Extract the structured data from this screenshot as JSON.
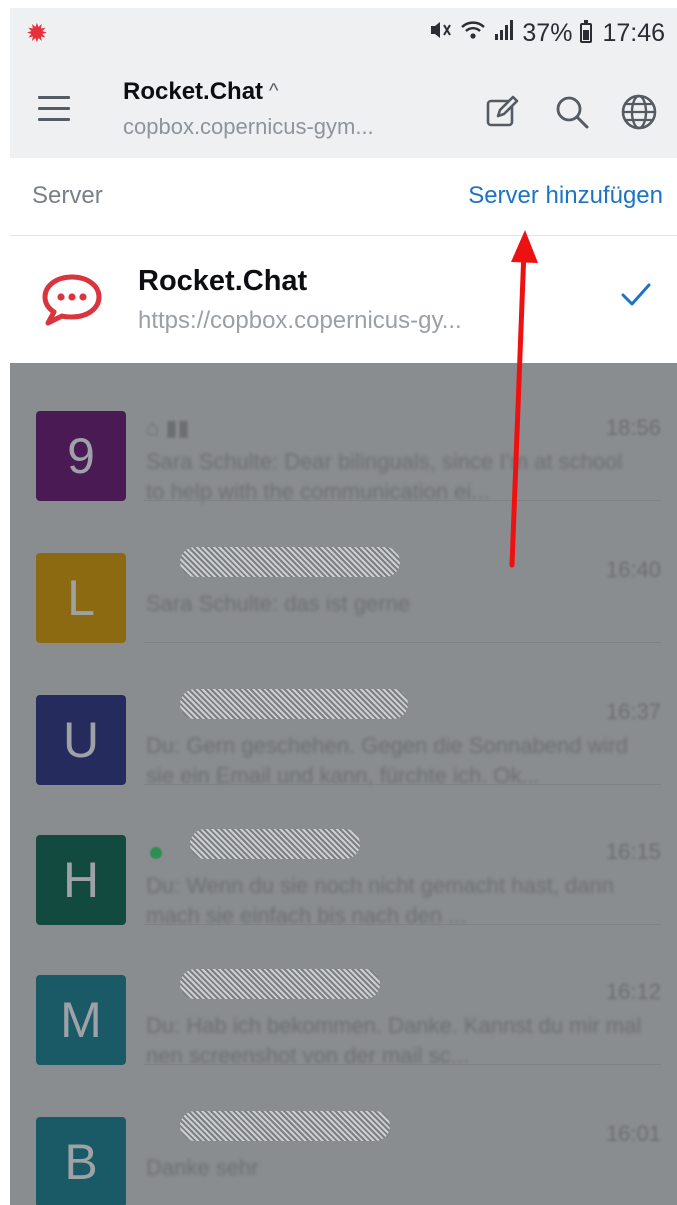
{
  "status_bar": {
    "icons": [
      "notification-icon",
      "mute-vibrate-icon",
      "wifi-icon",
      "signal-icon",
      "battery-icon"
    ],
    "battery": "37%",
    "time": "17:46"
  },
  "header": {
    "title": "Rocket.Chat",
    "caret": "^",
    "subtitle": "copbox.copernicus-gym...",
    "actions": [
      "compose-icon",
      "search-icon",
      "globe-icon"
    ]
  },
  "server_panel": {
    "label": "Server",
    "add_label": "Server hinzufügen",
    "servers": [
      {
        "name": "Rocket.Chat",
        "url": "https://copbox.copernicus-gy...",
        "selected": true
      }
    ]
  },
  "rooms": [
    {
      "avatar_letter": "9",
      "avatar_color": "#4a1a55",
      "time": "18:56",
      "message": "Sara Schulte: Dear bilinguals, since I'm at school to help with the communication ei..."
    },
    {
      "avatar_letter": "L",
      "avatar_color": "#8c6a12",
      "time": "16:40",
      "message": "Sara Schulte: das ist gerne"
    },
    {
      "avatar_letter": "U",
      "avatar_color": "#262b5e",
      "time": "16:37",
      "message": "Du: Gern geschehen. Gegen die Sonnabend wird sie ein Email und kann, fürchte ich. Ok..."
    },
    {
      "avatar_letter": "H",
      "avatar_color": "#134a3f",
      "time": "16:15",
      "message": "Du: Wenn du sie noch nicht gemacht hast, dann mach sie einfach bis nach den ..."
    },
    {
      "avatar_letter": "M",
      "avatar_color": "#1a5a66",
      "time": "16:12",
      "message": "Du: Hab ich bekommen. Danke. Kannst du mir mal nen screenshot von der mail sc..."
    },
    {
      "avatar_letter": "B",
      "avatar_color": "#1a5a66",
      "time": "16:01",
      "message": "Danke sehr"
    }
  ],
  "colors": {
    "accent": "#1d74c2",
    "header_bg": "#eef0f2",
    "overlay": "#8a8d90",
    "annotation_arrow": "#ee1111",
    "brand_logo": "#d9353f"
  }
}
